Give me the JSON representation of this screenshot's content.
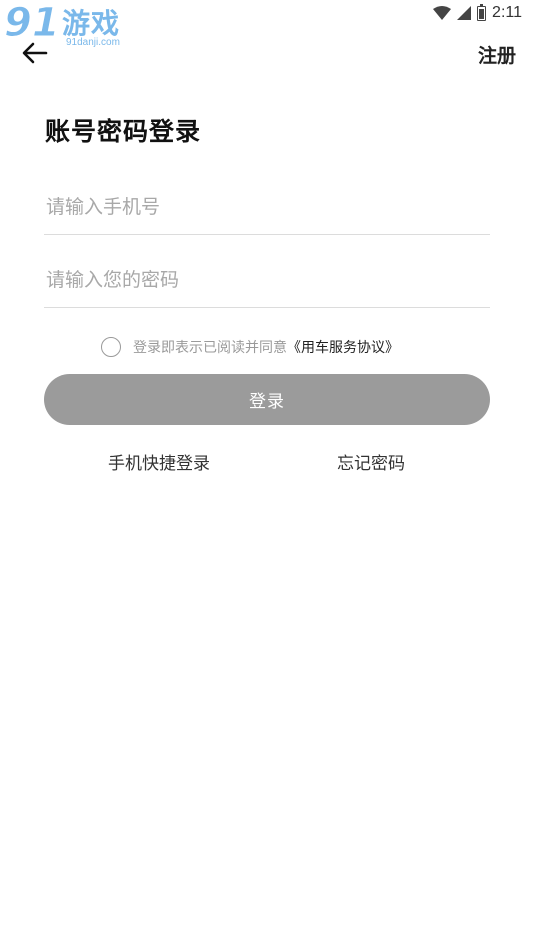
{
  "status_bar": {
    "time": "2:11"
  },
  "watermark": {
    "number": "91",
    "name": "游戏",
    "url": "91danji.com"
  },
  "header": {
    "register_label": "注册"
  },
  "page": {
    "title": "账号密码登录"
  },
  "form": {
    "phone_placeholder": "请输入手机号",
    "password_placeholder": "请输入您的密码",
    "agreement_text": "登录即表示已阅读并同意",
    "agreement_link": "《用车服务协议》",
    "login_label": "登录"
  },
  "links": {
    "quick_login": "手机快捷登录",
    "forgot_password": "忘记密码"
  },
  "colors": {
    "button_bg": "#9b9b9b",
    "logo": "#7ab8ea",
    "divider": "#dcdcdc"
  }
}
